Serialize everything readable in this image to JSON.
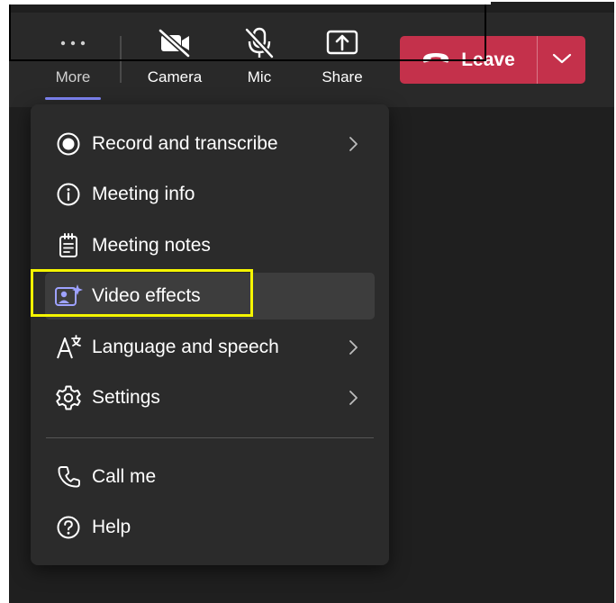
{
  "toolbar": {
    "more_label": "More",
    "camera_label": "Camera",
    "mic_label": "Mic",
    "share_label": "Share",
    "leave_label": "Leave"
  },
  "icons": {
    "more": "more-icon",
    "camera": "camera-off-icon",
    "mic": "mic-off-icon",
    "share": "share-icon",
    "leave": "phone-hangup-icon",
    "leave_dropdown": "chevron-down-icon"
  },
  "menu": {
    "items": [
      {
        "label": "Record and transcribe",
        "icon": "record-icon",
        "submenu": true
      },
      {
        "label": "Meeting info",
        "icon": "info-icon",
        "submenu": false
      },
      {
        "label": "Meeting notes",
        "icon": "notes-icon",
        "submenu": false
      },
      {
        "label": "Video effects",
        "icon": "video-effects-icon",
        "submenu": false,
        "highlighted": true
      },
      {
        "label": "Language and speech",
        "icon": "language-icon",
        "submenu": true
      },
      {
        "label": "Settings",
        "icon": "gear-icon",
        "submenu": true
      },
      {
        "label": "Call me",
        "icon": "phone-icon",
        "submenu": false
      },
      {
        "label": "Help",
        "icon": "help-icon",
        "submenu": false
      }
    ]
  },
  "colors": {
    "background": "#1f1f1f",
    "toolbar": "#292929",
    "menu": "#2b2b2b",
    "menu_hover": "#3d3d3d",
    "leave": "#c4314b",
    "accent": "#7f85f5",
    "annotation": "#f5f500"
  }
}
